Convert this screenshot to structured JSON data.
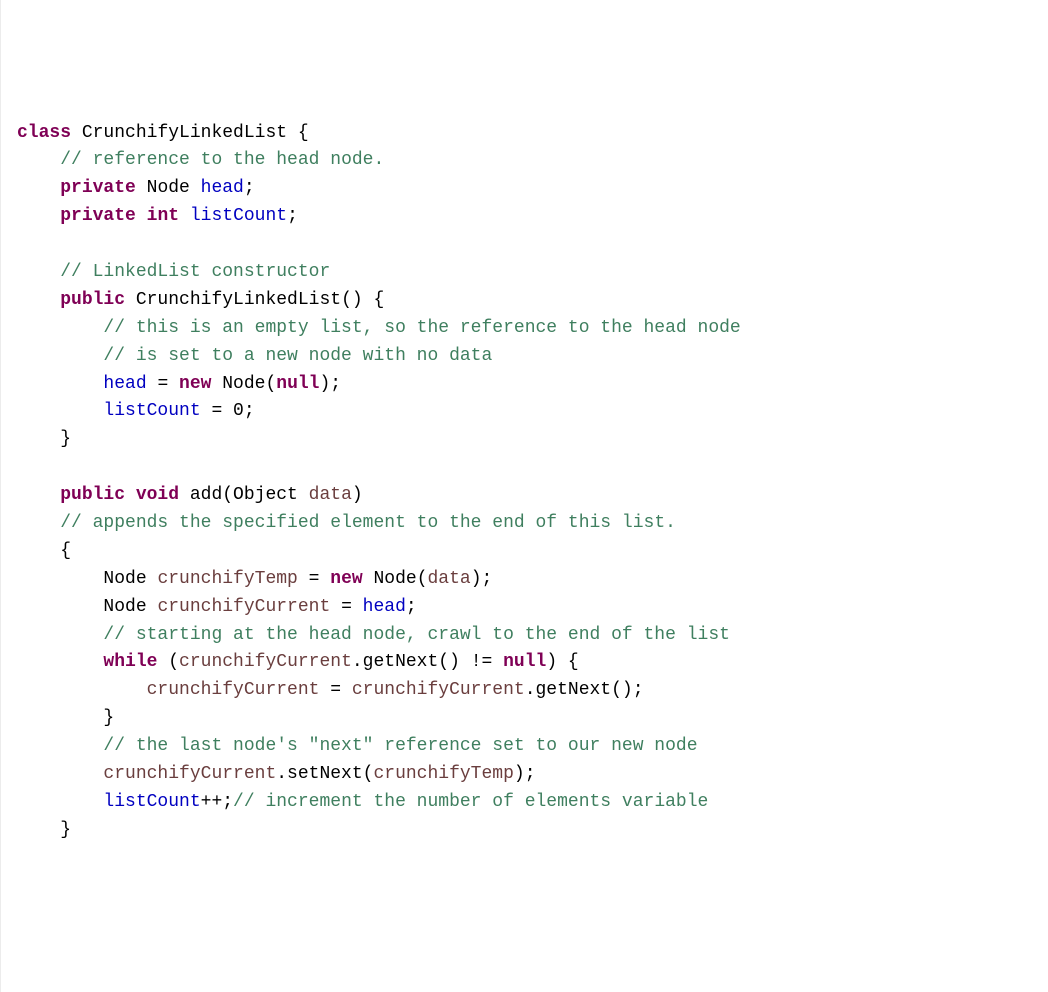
{
  "code": {
    "line01": {
      "kw_class": "class",
      "name": "CrunchifyLinkedList",
      "brace": " {"
    },
    "line02": {
      "indent": "    ",
      "comment": "// reference to the head node."
    },
    "line03": {
      "indent": "    ",
      "kw_private": "private",
      "type": " Node ",
      "field": "head",
      "semi": ";"
    },
    "line04": {
      "indent": "    ",
      "kw_private": "private",
      "kw_int": " int ",
      "field": "listCount",
      "semi": ";"
    },
    "line05": {
      "blank": " "
    },
    "line06": {
      "indent": "    ",
      "comment": "// LinkedList constructor"
    },
    "line07": {
      "indent": "    ",
      "kw_public": "public",
      "name": " CrunchifyLinkedList() {"
    },
    "line08": {
      "indent": "        ",
      "comment": "// this is an empty list, so the reference to the head node"
    },
    "line09": {
      "indent": "        ",
      "comment": "// is set to a new node with no data"
    },
    "line10": {
      "indent": "        ",
      "field": "head",
      "eq": " = ",
      "kw_new": "new",
      "rest_a": " Node(",
      "kw_null": "null",
      "rest_b": ");"
    },
    "line11": {
      "indent": "        ",
      "field": "listCount",
      "rest": " = 0;"
    },
    "line12": {
      "indent": "    ",
      "brace": "}"
    },
    "line13": {
      "blank": " "
    },
    "line14": {
      "indent": "    ",
      "kw_public": "public",
      "kw_void": " void ",
      "method": "add",
      "paren_a": "(Object ",
      "param": "data",
      "paren_b": ")"
    },
    "line15": {
      "indent": "    ",
      "comment": "// appends the specified element to the end of this list."
    },
    "line16": {
      "indent": "    ",
      "brace": "{"
    },
    "line17": {
      "indent": "        ",
      "pre": "Node ",
      "var": "crunchifyTemp",
      "eq": " = ",
      "kw_new": "new",
      "mid": " Node(",
      "param": "data",
      "end": ");"
    },
    "line18": {
      "indent": "        ",
      "pre": "Node ",
      "var": "crunchifyCurrent",
      "eq": " = ",
      "field": "head",
      "semi": ";"
    },
    "line19": {
      "indent": "        ",
      "comment": "// starting at the head node, crawl to the end of the list"
    },
    "line20": {
      "indent": "        ",
      "kw_while": "while",
      "open": " (",
      "var": "crunchifyCurrent",
      "call": ".getNext() != ",
      "kw_null": "null",
      "close": ") {"
    },
    "line21": {
      "indent": "            ",
      "var_a": "crunchifyCurrent",
      "eq": " = ",
      "var_b": "crunchifyCurrent",
      "call": ".getNext();"
    },
    "line22": {
      "indent": "        ",
      "brace": "}"
    },
    "line23": {
      "indent": "        ",
      "comment": "// the last node's \"next\" reference set to our new node"
    },
    "line24": {
      "indent": "        ",
      "var_a": "crunchifyCurrent",
      "mid": ".setNext(",
      "var_b": "crunchifyTemp",
      "end": ");"
    },
    "line25": {
      "indent": "        ",
      "field": "listCount",
      "inc": "++;",
      "comment": "// increment the number of elements variable"
    },
    "line26": {
      "indent": "    ",
      "brace": "}"
    }
  }
}
